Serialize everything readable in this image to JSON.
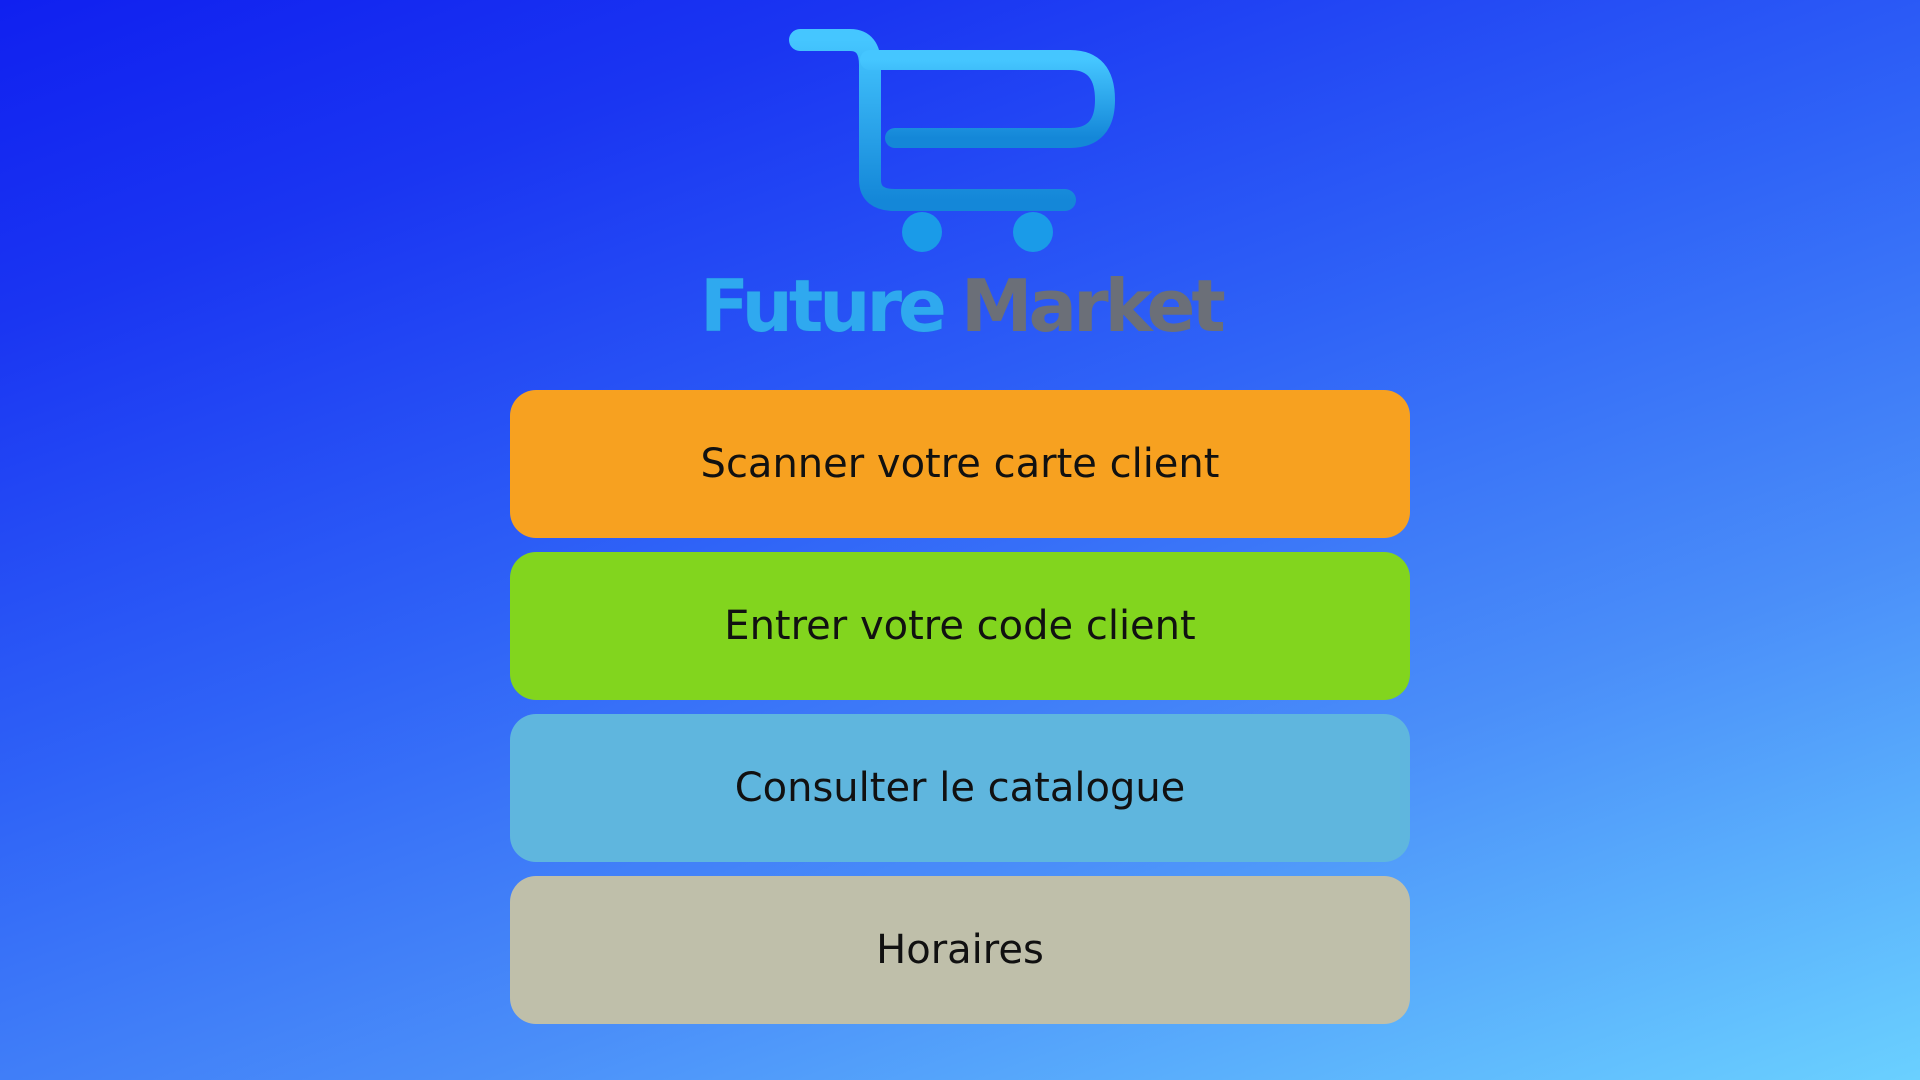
{
  "brand": {
    "name_part1": "Future",
    "name_part2": "Market",
    "logo_icon": "shopping-cart-icon"
  },
  "menu": {
    "items": [
      {
        "label": "Scanner votre carte client",
        "color": "#f7a120"
      },
      {
        "label": "Entrer votre code client",
        "color": "#82d51e"
      },
      {
        "label": "Consulter le catalogue",
        "color": "#5fb6de"
      },
      {
        "label": "Horaires",
        "color": "#bfbfaa"
      }
    ]
  },
  "colors": {
    "background_start": "#1020f0",
    "background_end": "#6ad0ff",
    "logo_blue": "#2fa9ef",
    "logo_gray": "#6b6f78"
  }
}
